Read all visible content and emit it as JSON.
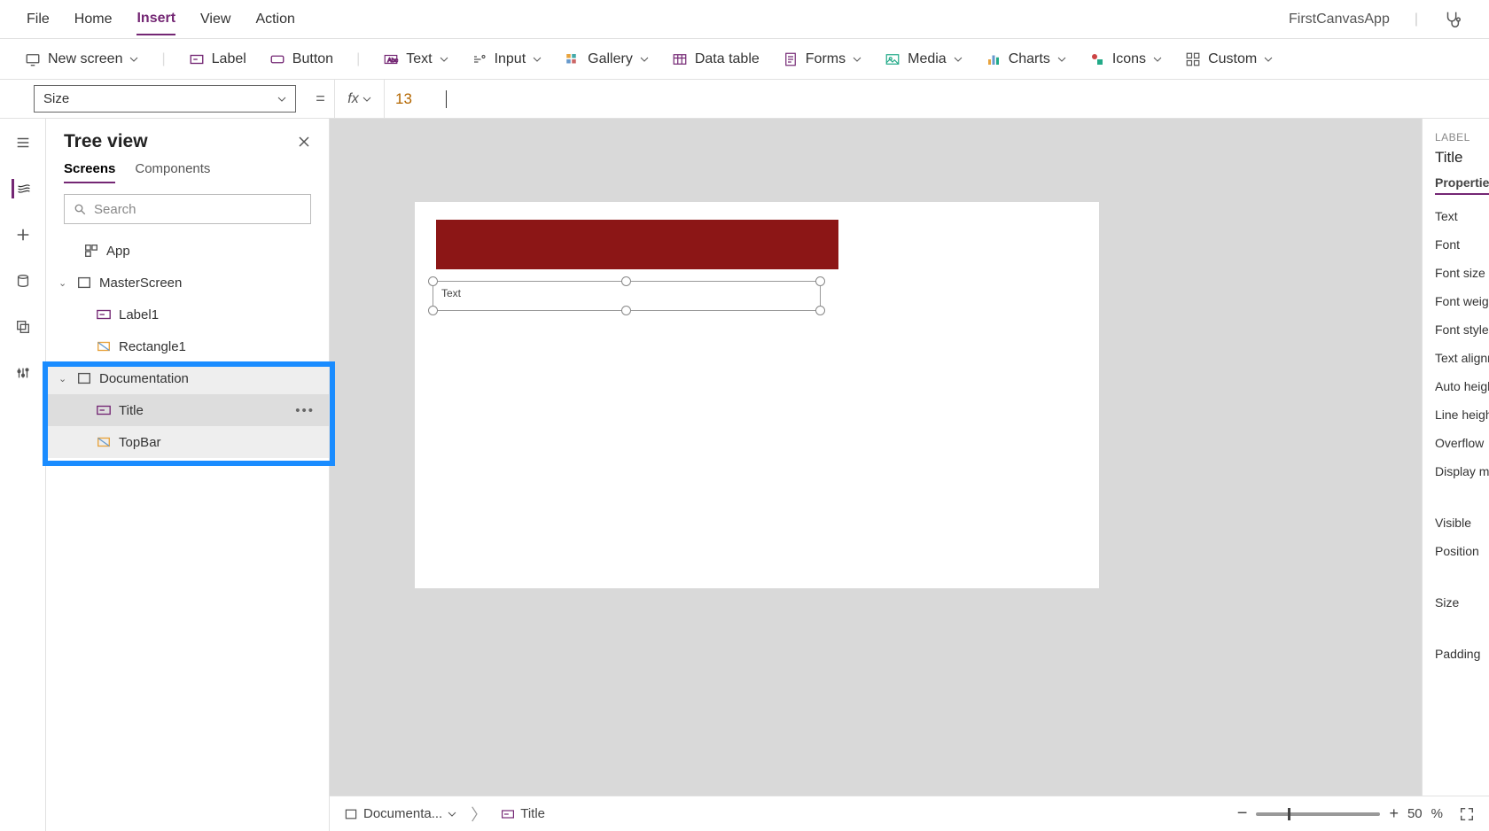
{
  "menubar": {
    "items": [
      "File",
      "Home",
      "Insert",
      "View",
      "Action"
    ],
    "active": "Insert",
    "app_name": "FirstCanvasApp"
  },
  "ribbon": {
    "new_screen": "New screen",
    "label": "Label",
    "button": "Button",
    "text": "Text",
    "input": "Input",
    "gallery": "Gallery",
    "data_table": "Data table",
    "forms": "Forms",
    "media": "Media",
    "charts": "Charts",
    "icons": "Icons",
    "custom": "Custom"
  },
  "fx": {
    "property": "Size",
    "eq": "=",
    "fx": "fx",
    "value": "13"
  },
  "tree": {
    "title": "Tree view",
    "tabs": {
      "screens": "Screens",
      "components": "Components",
      "active": "Screens"
    },
    "search_placeholder": "Search",
    "app": "App",
    "nodes": [
      {
        "name": "MasterScreen",
        "children": [
          {
            "name": "Label1",
            "icon": "label"
          },
          {
            "name": "Rectangle1",
            "icon": "rect"
          }
        ]
      },
      {
        "name": "Documentation",
        "children": [
          {
            "name": "Title",
            "icon": "label",
            "selected": true
          },
          {
            "name": "TopBar",
            "icon": "rect"
          }
        ]
      }
    ]
  },
  "canvas": {
    "selected_text": "Text"
  },
  "status": {
    "breadcrumb_screen": "Documenta...",
    "breadcrumb_item": "Title",
    "zoom_value": "50",
    "zoom_suffix": "%",
    "minus": "−",
    "plus": "+"
  },
  "props": {
    "kind": "LABEL",
    "name": "Title",
    "tab_properties": "Properties",
    "fields": [
      "Text",
      "Font",
      "Font size",
      "Font weight",
      "Font style",
      "Text alignme",
      "Auto height",
      "Line height",
      "Overflow",
      "Display mod"
    ],
    "fields2": [
      "Visible",
      "Position"
    ],
    "fields3": [
      "Size"
    ],
    "fields4": [
      "Padding"
    ]
  }
}
